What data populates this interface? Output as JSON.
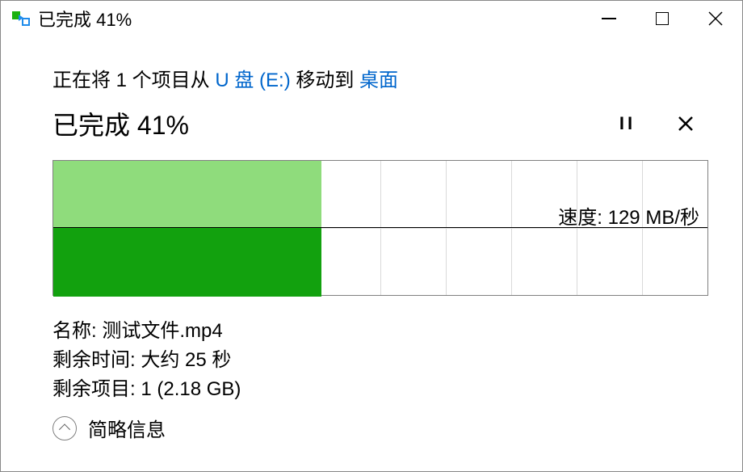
{
  "window": {
    "title": "已完成 41%"
  },
  "operation": {
    "prefix": "正在将 1 个项目从 ",
    "source": "U 盘 (E:)",
    "middle": " 移动到 ",
    "destination": "桌面"
  },
  "progress": {
    "title": "已完成 41%",
    "percent": 41
  },
  "chart_data": {
    "type": "area",
    "title": "",
    "xlabel": "",
    "ylabel": "",
    "ylim": [
      0,
      260
    ],
    "speed_label": "速度: 129 MB/秒",
    "current_speed_mb_s": 129,
    "progress_percent": 41,
    "grid": {
      "columns": 10,
      "rows": 2
    }
  },
  "details": {
    "name_label": "名称: ",
    "name_value": "测试文件.mp4",
    "time_label": "剩余时间: ",
    "time_value": "大约 25 秒",
    "items_label": "剩余项目: ",
    "items_value": "1 (2.18 GB)"
  },
  "footer": {
    "toggle_label": "简略信息"
  }
}
